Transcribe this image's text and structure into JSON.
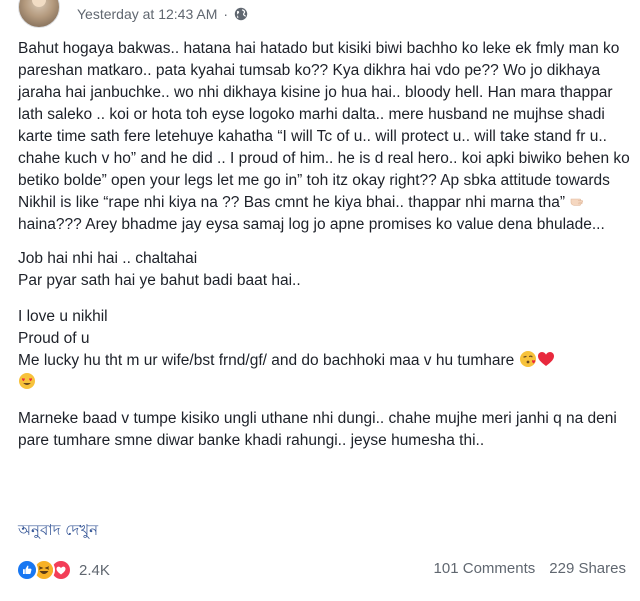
{
  "post": {
    "timestamp": "Yesterday at 12:43 AM",
    "separator": "·",
    "audience_icon": "globe-icon",
    "paragraphs": {
      "p1": "Bahut hogaya bakwas.. hatana hai hatado but kisiki biwi bachho ko leke ek fmly man ko pareshan matkaro.. pata kyahai tumsab ko?? Kya dikhra hai vdo pe?? Wo jo dikhaya jaraha hai janbuchke.. wo nhi dikhaya kisine jo hua hai.. bloody hell. Han mara thappar lath saleko .. koi or hota toh eyse logoko marhi dalta.. mere husband ne mujhse shadi karte time sath fere letehuye kahatha “I will Tc of u.. will protect u.. will take stand fr u.. chahe kuch v ho” and he did .. I proud of him.. he is d real hero.. koi apki biwiko behen ko betiko bolde” open your legs let me go in” toh itz okay right?? Ap sbka attitude towards Nikhil is like “rape nhi kiya na ?? Bas cmnt he kiya bhai.. thappar nhi marna tha”",
      "p1_end": "haina??? Arey bhadme jay eysa samaj log jo apne promises ko value dena bhulade...",
      "p2_line1": "Job hai nhi hai .. chaltahai",
      "p2_line2": "Par pyar sath hai ye bahut badi baat hai..",
      "p3_line1": "I love u nikhil",
      "p3_line2": "Proud of u",
      "p3_line3": "Me lucky hu tht m ur wife/bst frnd/gf/ and do bachhoki maa v hu tumhare",
      "p4": "Marneke baad v tumpe kisiko ungli uthane nhi dungi.. chahe mujhe meri janhi q na deni pare tumhare smne diwar banke khadi rahungi.. jeyse humesha thi.."
    },
    "emojis": {
      "hand": "pointing-hand-icon",
      "kiss": "face-blowing-kiss-icon",
      "heart": "red-heart-icon",
      "heart_eyes": "heart-eyes-face-icon"
    },
    "translate_label": "অনুবাদ দেখুন",
    "reactions": {
      "types": [
        "like-reaction-icon",
        "haha-reaction-icon",
        "love-reaction-icon"
      ],
      "count": "2.4K"
    },
    "comments_label": "101 Comments",
    "shares_label": "229 Shares",
    "colors": {
      "text": "#1d2129",
      "meta": "#606770",
      "link": "#385898",
      "like": "#1877f2",
      "love": "#f33e58",
      "haha": "#f7b125"
    }
  }
}
